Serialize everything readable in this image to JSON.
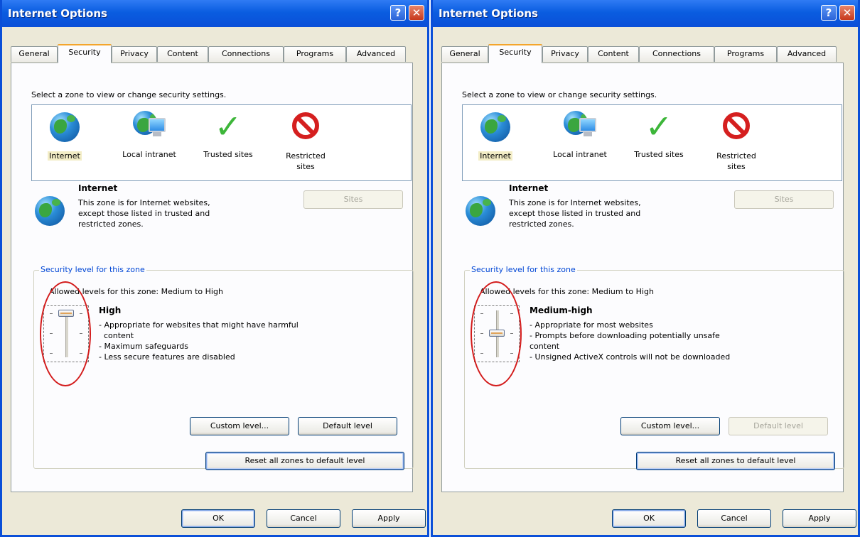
{
  "dialogs": [
    {
      "title": "Internet Options",
      "title_buttons": {
        "help": "?",
        "close": "✕"
      },
      "tabs": [
        "General",
        "Security",
        "Privacy",
        "Content",
        "Connections",
        "Programs",
        "Advanced"
      ],
      "active_tab": "Security",
      "select_zone_label": "Select a zone to view or change security settings.",
      "zones": [
        {
          "label": "Internet",
          "icon": "globe-icon",
          "selected": true
        },
        {
          "label": "Local intranet",
          "icon": "local-intranet-icon",
          "selected": false
        },
        {
          "label": "Trusted sites",
          "icon": "checkmark-icon",
          "selected": false
        },
        {
          "label": "Restricted\nsites",
          "icon": "restricted-icon",
          "selected": false
        }
      ],
      "zone_info": {
        "title": "Internet",
        "description": "This zone is for Internet websites,\nexcept those listed in trusted and\nrestricted zones."
      },
      "sites_button": "Sites",
      "security_group_label": "Security level for this zone",
      "allowed_levels": "Allowed levels for this zone: Medium to High",
      "slider_level_fraction": 1.0,
      "level_name": "High",
      "level_description": [
        "- Appropriate for websites that might have harmful",
        "  content",
        "- Maximum safeguards",
        "- Less secure features are disabled"
      ],
      "custom_level_button": "Custom level...",
      "default_level_button": "Default level",
      "default_level_enabled": true,
      "reset_all_button": "Reset all zones to default level",
      "ok_button": "OK",
      "cancel_button": "Cancel",
      "apply_button": "Apply"
    },
    {
      "title": "Internet Options",
      "title_buttons": {
        "help": "?",
        "close": "✕"
      },
      "tabs": [
        "General",
        "Security",
        "Privacy",
        "Content",
        "Connections",
        "Programs",
        "Advanced"
      ],
      "active_tab": "Security",
      "select_zone_label": "Select a zone to view or change security settings.",
      "zones": [
        {
          "label": "Internet",
          "icon": "globe-icon",
          "selected": true
        },
        {
          "label": "Local intranet",
          "icon": "local-intranet-icon",
          "selected": false
        },
        {
          "label": "Trusted sites",
          "icon": "checkmark-icon",
          "selected": false
        },
        {
          "label": "Restricted\nsites",
          "icon": "restricted-icon",
          "selected": false
        }
      ],
      "zone_info": {
        "title": "Internet",
        "description": "This zone is for Internet websites,\nexcept those listed in trusted and\nrestricted zones."
      },
      "sites_button": "Sites",
      "security_group_label": "Security level for this zone",
      "allowed_levels": "Allowed levels for this zone: Medium to High",
      "slider_level_fraction": 0.5,
      "level_name": "Medium-high",
      "level_description": [
        "- Appropriate for most websites",
        "- Prompts before downloading potentially unsafe",
        "content",
        "- Unsigned ActiveX controls will not be downloaded"
      ],
      "custom_level_button": "Custom level...",
      "default_level_button": "Default level",
      "default_level_enabled": false,
      "reset_all_button": "Reset all zones to default level",
      "ok_button": "OK",
      "cancel_button": "Cancel",
      "apply_button": "Apply"
    }
  ],
  "colors": {
    "titlebar": "#0a4fd8",
    "dialog_background": "#ece9d8",
    "active_tab_accent": "#f4a52b",
    "group_label": "#0046d5",
    "highlight_ellipse": "#d31b1b"
  }
}
